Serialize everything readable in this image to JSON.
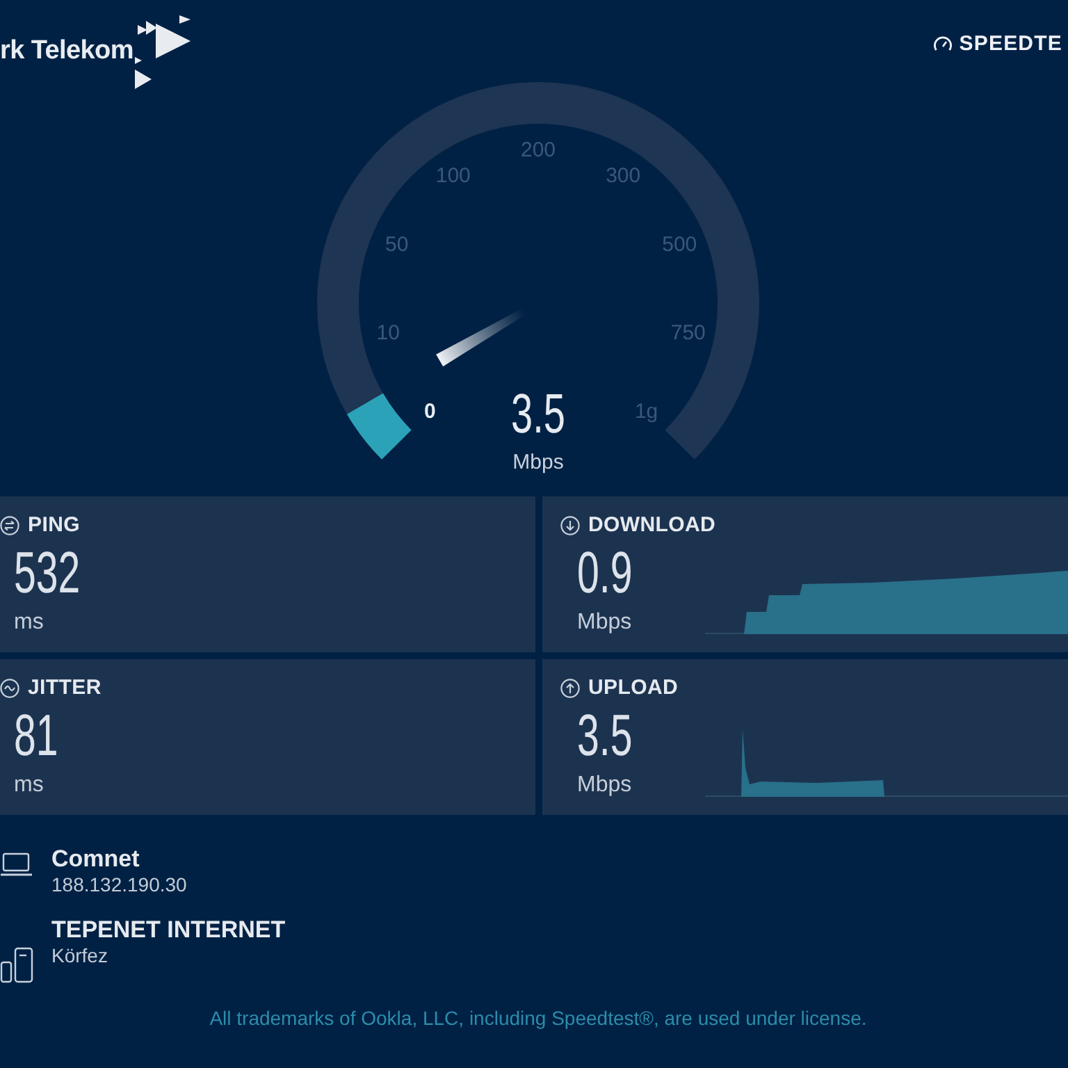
{
  "header": {
    "brand": "rk Telekom",
    "speedtest_link": "SPEEDTE"
  },
  "gauge": {
    "ticks": [
      "0",
      "10",
      "50",
      "100",
      "200",
      "300",
      "500",
      "750",
      "1g"
    ],
    "level": 0.055,
    "value": "3.5",
    "unit": "Mbps"
  },
  "metrics": [
    {
      "kind": "ping",
      "label": "PING",
      "value": "532",
      "unit": "ms"
    },
    {
      "kind": "download",
      "label": "DOWNLOAD",
      "value": "0.9",
      "unit": "Mbps"
    },
    {
      "kind": "jitter",
      "label": "JITTER",
      "value": "81",
      "unit": "ms"
    },
    {
      "kind": "upload",
      "label": "UPLOAD",
      "value": "3.5",
      "unit": "Mbps"
    }
  ],
  "connection": [
    {
      "kind": "client",
      "name": "Comnet",
      "detail": "188.132.190.30"
    },
    {
      "kind": "server",
      "name": "TEPENET INTERNET",
      "detail": "Körfez"
    }
  ],
  "footer": "All trademarks of Ookla, LLC, including Speedtest®, are used under license."
}
